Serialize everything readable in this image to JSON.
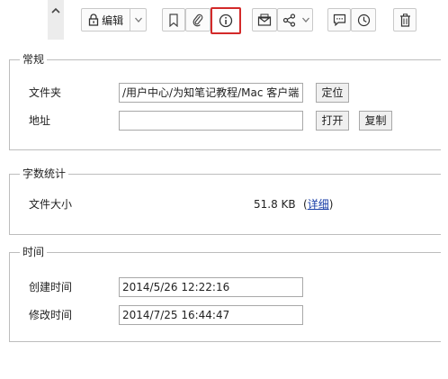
{
  "toolbar": {
    "edit_label": "编辑",
    "icons": [
      "up-arrow-icon",
      "lock-icon",
      "chevron-down-icon",
      "bookmark-icon",
      "paperclip-icon",
      "info-icon",
      "envelope-icon",
      "share-icon",
      "comment-icon",
      "clock-icon",
      "trash-icon"
    ],
    "selected_tool": "info-icon",
    "selected_color": "#d32a2a"
  },
  "general": {
    "title": "常规",
    "folder_label": "文件夹",
    "folder_value": "/用户中心/为知笔记教程/Mac 客户端",
    "locate_label": "定位",
    "url_label": "地址",
    "url_value": "",
    "open_label": "打开",
    "copy_label": "复制"
  },
  "stats": {
    "title": "字数统计",
    "size_label": "文件大小",
    "size_value": "51.8 KB",
    "details_open": "(",
    "details_label": "详细",
    "details_close": ")"
  },
  "time": {
    "title": "时间",
    "created_label": "创建时间",
    "created_value": "2014/5/26 12:22:16",
    "modified_label": "修改时间",
    "modified_value": "2014/7/25 16:44:47"
  }
}
